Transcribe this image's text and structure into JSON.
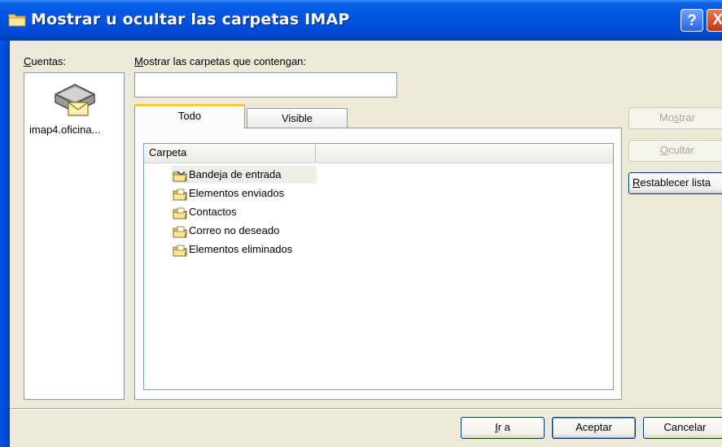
{
  "window": {
    "title": "Mostrar u ocultar las carpetas IMAP",
    "help_glyph": "?",
    "close_glyph": "X"
  },
  "accounts": {
    "label": "Cuentas:",
    "items": [
      {
        "label": "imap4.oficina...",
        "icon": "mail-server-icon"
      }
    ]
  },
  "filter": {
    "label": "Mostrar las carpetas que contengan:",
    "value": "",
    "placeholder": ""
  },
  "tabs": [
    {
      "label": "Todo",
      "active": true
    },
    {
      "label": "Visible",
      "active": false
    }
  ],
  "folder_list": {
    "column_header": "Carpeta",
    "rows": [
      {
        "label": "Bandeja de entrada",
        "selected": true,
        "icon": "inbox-folder-icon"
      },
      {
        "label": "Elementos enviados",
        "selected": false,
        "icon": "folder-icon"
      },
      {
        "label": "Contactos",
        "selected": false,
        "icon": "folder-icon"
      },
      {
        "label": "Correo no deseado",
        "selected": false,
        "icon": "folder-icon"
      },
      {
        "label": "Elementos eliminados",
        "selected": false,
        "icon": "folder-icon"
      }
    ]
  },
  "side_buttons": {
    "show": {
      "label": "Mostrar",
      "enabled": false
    },
    "hide": {
      "label": "Ocultar",
      "enabled": false
    },
    "reset": {
      "label": "Restablecer lista",
      "enabled": true
    }
  },
  "footer_buttons": {
    "goto": "Ir a",
    "accept": "Aceptar",
    "cancel": "Cancelar"
  },
  "colors": {
    "titlebar": "#0055e5",
    "dialog_bg": "#ece9d8",
    "active_tab_accent": "#ffc83c"
  }
}
